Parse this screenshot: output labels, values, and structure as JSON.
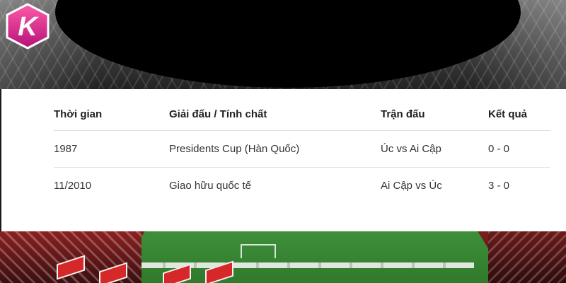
{
  "brand": {
    "logo_letter": "K",
    "logo_colors": {
      "top": "#ff4fa0",
      "bottom": "#b5127a"
    }
  },
  "table": {
    "headers": {
      "time": "Thời gian",
      "tournament": "Giải đấu / Tính chất",
      "match": "Trận đấu",
      "result": "Kết quả"
    },
    "rows": [
      {
        "time": "1987",
        "tournament": "Presidents Cup (Hàn Quốc)",
        "match": "Úc vs Ai Cập",
        "result": "0 - 0"
      },
      {
        "time": "11/2010",
        "tournament": "Giao hữu quốc tế",
        "match": "Ai Cập vs Úc",
        "result": "3 - 0"
      }
    ]
  },
  "colors": {
    "panel_bg": "#ffffff",
    "text": "#2b2b2b",
    "divider": "#e0e0e0"
  }
}
